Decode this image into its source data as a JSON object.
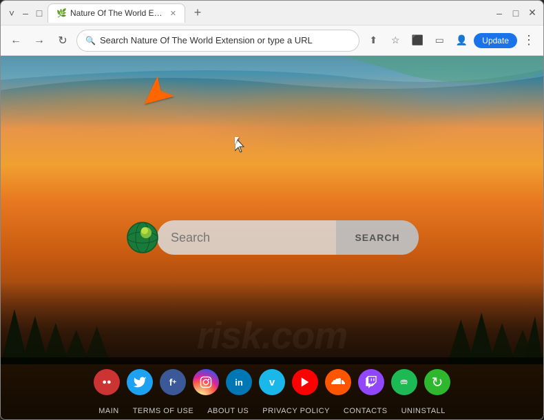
{
  "browser": {
    "tab": {
      "title": "Nature Of The World Extension",
      "favicon": "🌿"
    },
    "address_bar": {
      "url": "Search Nature Of The World Extension or type a URL",
      "placeholder": "Search Nature Of The World Extension or type a URL"
    },
    "controls": {
      "minimize": "–",
      "maximize": "□",
      "close": "✕",
      "chevron_down": "˅",
      "new_tab": "+",
      "back": "←",
      "forward": "→",
      "refresh": "↻",
      "share": "⬆",
      "bookmark": "☆",
      "extensions": "⬛",
      "sidebar": "▭",
      "profile": "👤",
      "update_label": "Update",
      "more": "⋮"
    }
  },
  "page": {
    "search": {
      "placeholder": "Search",
      "button_label": "SEARCH"
    },
    "bottom_nav": {
      "links": [
        {
          "label": "MAIN",
          "id": "main"
        },
        {
          "label": "TERMS OF USE",
          "id": "terms"
        },
        {
          "label": "ABOUT US",
          "id": "about"
        },
        {
          "label": "PRIVACY POLICY",
          "id": "privacy"
        },
        {
          "label": "CONTACTS",
          "id": "contacts"
        },
        {
          "label": "UNINSTALL",
          "id": "uninstall"
        }
      ]
    },
    "social_icons": [
      {
        "name": "custom-red",
        "color": "#cc3333",
        "icon": "●●"
      },
      {
        "name": "twitter-bird",
        "color": "#1da1f2",
        "icon": "🐦"
      },
      {
        "name": "facebook-plus",
        "color": "#3b5998",
        "icon": "f+"
      },
      {
        "name": "instagram",
        "color": "#c13584",
        "icon": "📷"
      },
      {
        "name": "linkedin",
        "color": "#0077b5",
        "icon": "in"
      },
      {
        "name": "vimeo",
        "color": "#1ab7ea",
        "icon": "v"
      },
      {
        "name": "youtube",
        "color": "#ff0000",
        "icon": "▶"
      },
      {
        "name": "soundcloud",
        "color": "#ff5500",
        "icon": "☁"
      },
      {
        "name": "twitch",
        "color": "#9146ff",
        "icon": "⬛"
      },
      {
        "name": "spotify",
        "color": "#1db954",
        "icon": "♫"
      },
      {
        "name": "refresh-green",
        "color": "#2eb82e",
        "icon": "↻"
      }
    ],
    "arrow": {
      "color": "#ff6600"
    }
  }
}
